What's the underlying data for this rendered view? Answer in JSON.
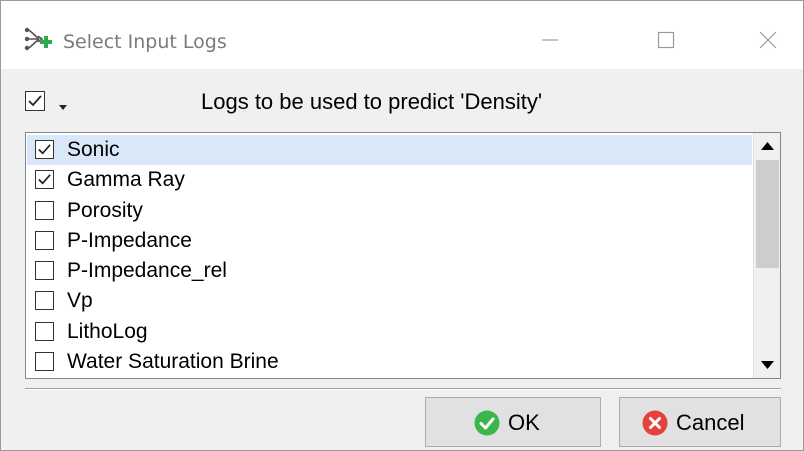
{
  "window": {
    "title": "Select Input Logs",
    "title_icon": "input-logs-icon"
  },
  "title_buttons": {
    "minimize_icon": "minimize-icon",
    "maximize_icon": "maximize-icon",
    "close_icon": "close-icon"
  },
  "header": {
    "label": "Logs to be used to predict 'Density'",
    "select_all_checked": true
  },
  "logs": [
    {
      "label": "Sonic",
      "checked": true,
      "selected": true
    },
    {
      "label": "Gamma Ray",
      "checked": true,
      "selected": false
    },
    {
      "label": "Porosity",
      "checked": false,
      "selected": false
    },
    {
      "label": "P-Impedance",
      "checked": false,
      "selected": false
    },
    {
      "label": "P-Impedance_rel",
      "checked": false,
      "selected": false
    },
    {
      "label": "Vp",
      "checked": false,
      "selected": false
    },
    {
      "label": "LithoLog",
      "checked": false,
      "selected": false
    },
    {
      "label": "Water Saturation Brine",
      "checked": false,
      "selected": false
    }
  ],
  "buttons": {
    "ok_label": "OK",
    "cancel_label": "Cancel",
    "ok_icon": "green-check-icon",
    "cancel_icon": "red-x-icon"
  },
  "colors": {
    "selection": "#d9e8f9",
    "ok_green": "#3cb54a",
    "cancel_red": "#e5413c",
    "title_icon_green": "#2eaa4a"
  }
}
